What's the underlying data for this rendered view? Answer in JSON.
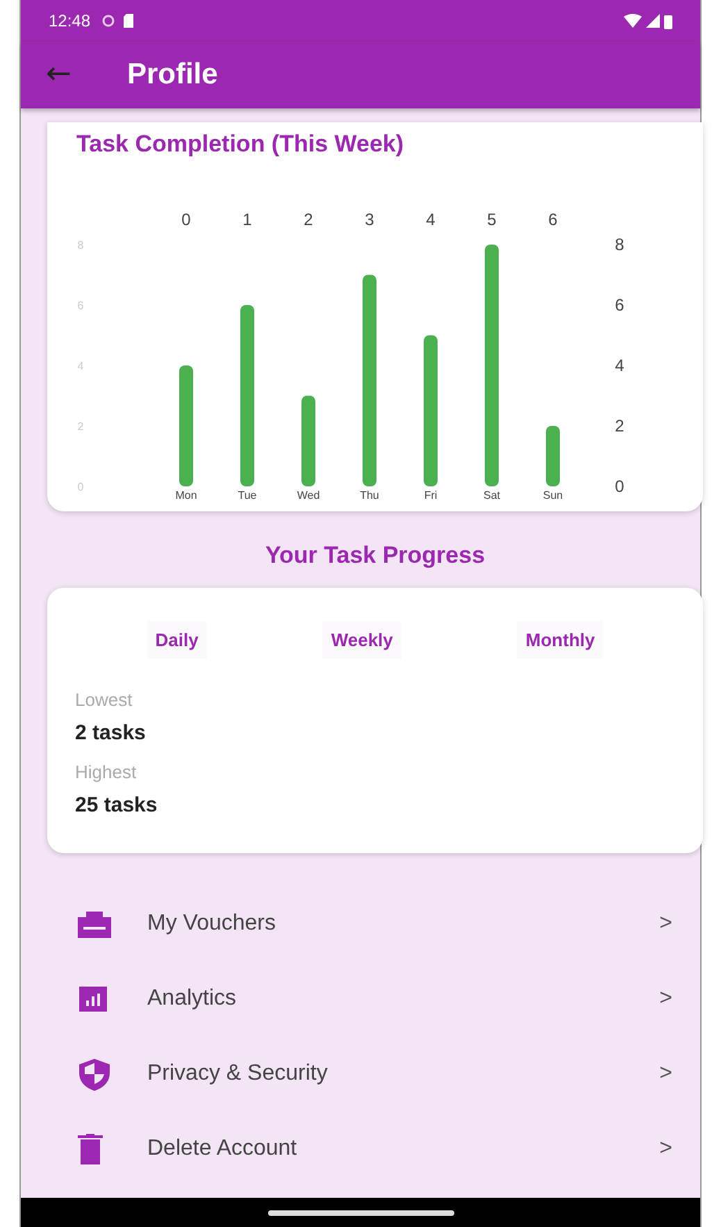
{
  "status_bar": {
    "time": "12:48"
  },
  "app_bar": {
    "back": "←",
    "title": "Profile"
  },
  "chart_card": {
    "title": "Task Completion (This Week)",
    "chart_data": {
      "type": "bar",
      "categories": [
        "Mon",
        "Tue",
        "Wed",
        "Thu",
        "Fri",
        "Sat",
        "Sun"
      ],
      "series": [
        {
          "color": "#4caf50",
          "values": [
            4,
            6,
            3,
            7,
            5,
            8,
            2
          ]
        }
      ],
      "ylim": [
        0,
        8
      ],
      "yticks": [
        0,
        2,
        4,
        6,
        8
      ]
    },
    "top_labels": [
      "0",
      "1",
      "2",
      "3",
      "4",
      "5",
      "6"
    ],
    "left_axis_labels": [
      "8",
      "6",
      "4",
      "2",
      "0"
    ]
  },
  "progress": {
    "heading": "Your Task Progress",
    "tabs": [
      {
        "label": "Daily"
      },
      {
        "label": "Weekly"
      },
      {
        "label": "Monthly"
      }
    ],
    "stats": [
      {
        "label": "Lowest",
        "value": "2 tasks"
      },
      {
        "label": "Highest",
        "value": "25 tasks"
      }
    ]
  },
  "menu": [
    {
      "kind": "voucher",
      "label": "My Vouchers",
      "chevron": ">"
    },
    {
      "kind": "analytics",
      "label": "Analytics",
      "chevron": ">"
    },
    {
      "kind": "privacy",
      "label": "Privacy & Security",
      "chevron": ">"
    },
    {
      "kind": "delete",
      "label": "Delete Account",
      "chevron": ">"
    }
  ]
}
